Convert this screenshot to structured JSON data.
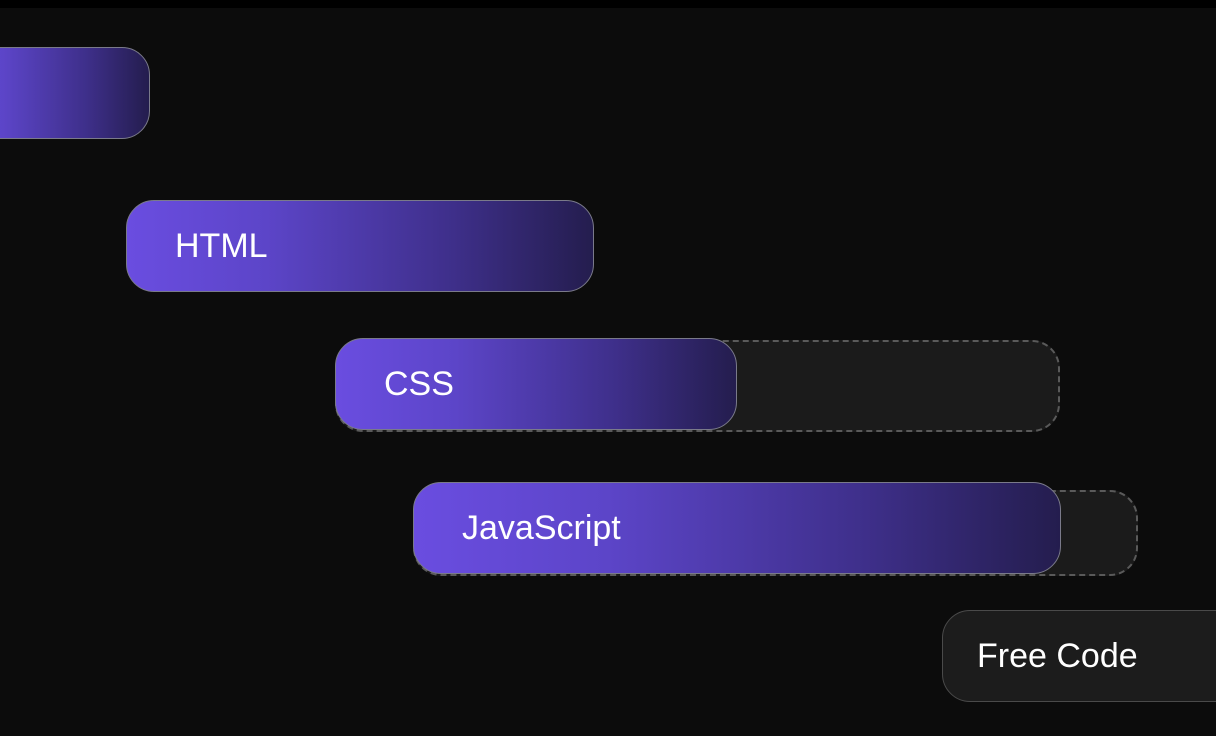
{
  "bars": {
    "partial": {
      "label": ""
    },
    "html": {
      "label": "HTML"
    },
    "css": {
      "label": "CSS"
    },
    "javascript": {
      "label": "JavaScript"
    },
    "freecode": {
      "label": "Free Code"
    }
  },
  "colors": {
    "background": "#0c0c0c",
    "purple_start": "#6a4de0",
    "purple_end": "#241d4e",
    "ghost_border": "#5a5a5a",
    "ghost_fill": "#1b1b1b",
    "dark_fill": "#1c1c1c",
    "text": "#ffffff"
  }
}
